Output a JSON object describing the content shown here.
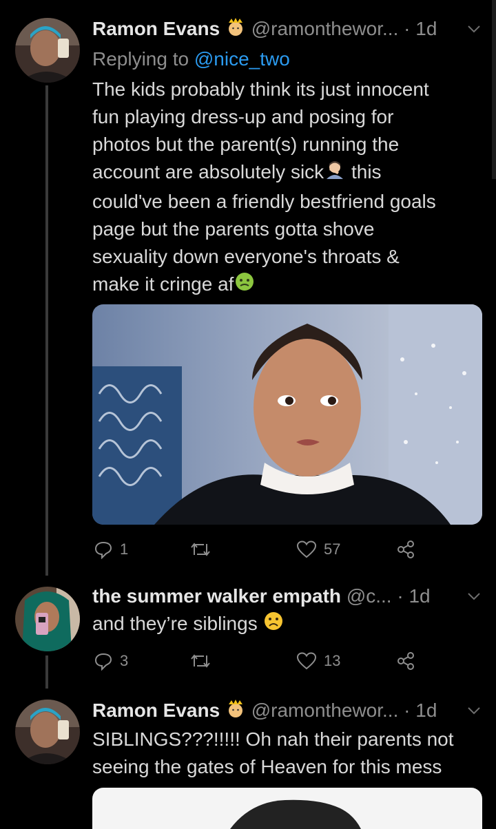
{
  "tweets": [
    {
      "name": "Ramon Evans",
      "handle": "@ramonthewor...",
      "dot": "·",
      "age": "1d",
      "reply_prefix": "Replying to ",
      "reply_to": "@nice_two",
      "lines": [
        "The kids probably think its just innocent",
        "fun playing dress-up and posing for",
        "photos but the parent(s) running the",
        "account are absolutely sick",
        "this",
        "could've been a friendly bestfriend goals",
        "page but the parents gotta shove",
        "sexuality down everyone's throats &",
        "make it cringe af"
      ],
      "replies": "1",
      "retweets": "",
      "likes": "57"
    },
    {
      "name": "the summer walker empath",
      "handle": "@c...",
      "dot": "·",
      "age": "1d",
      "text": "and they’re siblings",
      "replies": "3",
      "retweets": "",
      "likes": "13"
    },
    {
      "name": "Ramon Evans",
      "handle": "@ramonthewor...",
      "dot": "·",
      "age": "1d",
      "lines": [
        "SIBLINGS???!!!!! Oh nah their parents not",
        "seeing the gates of Heaven for this mess"
      ]
    }
  ],
  "icons": {
    "reply": "reply-icon",
    "retweet": "retweet-icon",
    "like": "heart-icon",
    "share": "share-icon",
    "more": "chevron-down-icon",
    "verified": "crown-emoji"
  },
  "colors": {
    "background": "#000000",
    "link": "#2b9bf0",
    "muted": "#8e8e8e",
    "text": "#d9d9d9"
  }
}
